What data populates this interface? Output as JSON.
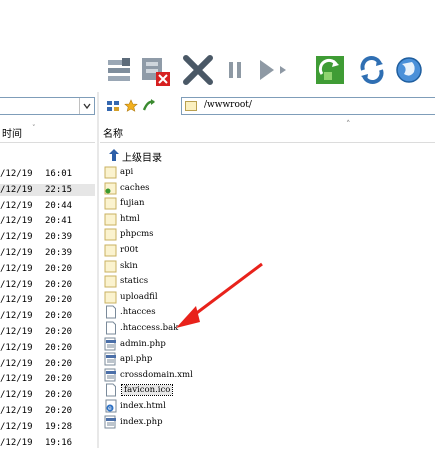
{
  "left_pane": {
    "header": "时间",
    "rows": [
      {
        "date": "/12/19",
        "time": "16:01"
      },
      {
        "date": "/12/19",
        "time": "22:15",
        "selected": true
      },
      {
        "date": "/12/19",
        "time": "20:44"
      },
      {
        "date": "/12/19",
        "time": "20:41"
      },
      {
        "date": "/12/19",
        "time": "20:39"
      },
      {
        "date": "/12/19",
        "time": "20:39"
      },
      {
        "date": "/12/19",
        "time": "20:20"
      },
      {
        "date": "/12/19",
        "time": "20:20"
      },
      {
        "date": "/12/19",
        "time": "20:20"
      },
      {
        "date": "/12/19",
        "time": "20:20"
      },
      {
        "date": "/12/19",
        "time": "20:20"
      },
      {
        "date": "/12/19",
        "time": "20:20"
      },
      {
        "date": "/12/19",
        "time": "20:20"
      },
      {
        "date": "/12/19",
        "time": "20:20"
      },
      {
        "date": "/12/19",
        "time": "20:20"
      },
      {
        "date": "/12/19",
        "time": "20:20"
      },
      {
        "date": "/12/19",
        "time": "19:28"
      },
      {
        "date": "/12/19",
        "time": "19:16"
      }
    ]
  },
  "right_pane": {
    "path": "/wwwroot/",
    "header": "名称",
    "parent_label": "上级目录",
    "files": [
      {
        "name": "api",
        "type": "folder"
      },
      {
        "name": "caches",
        "type": "folder-special"
      },
      {
        "name": "fujian",
        "type": "folder"
      },
      {
        "name": "html",
        "type": "folder"
      },
      {
        "name": "phpcms",
        "type": "folder"
      },
      {
        "name": "r00t",
        "type": "folder"
      },
      {
        "name": "skin",
        "type": "folder"
      },
      {
        "name": "statics",
        "type": "folder"
      },
      {
        "name": "uploadfil",
        "type": "folder"
      },
      {
        "name": ".htacces",
        "type": "file"
      },
      {
        "name": ".htaccess.bak",
        "type": "file"
      },
      {
        "name": "admin.php",
        "type": "php"
      },
      {
        "name": "api.php",
        "type": "php"
      },
      {
        "name": "crossdomain.xml",
        "type": "xml"
      },
      {
        "name": "favicon.ico",
        "type": "file",
        "selected": true
      },
      {
        "name": "index.html",
        "type": "html"
      },
      {
        "name": "index.php",
        "type": "php"
      }
    ]
  },
  "icons": {
    "transfer": "transfer-queue-icon",
    "delete_queue": "delete-queue-icon",
    "cancel": "cancel-icon",
    "pause": "pause-icon",
    "play": "start-transfer-icon",
    "refresh_green": "refresh-local-icon",
    "refresh_blue": "sync-icon",
    "world": "site-manager-icon"
  },
  "colors": {
    "annotation_arrow": "#e8221b",
    "folder": "#f6df8c",
    "selection": "#e6e6e6"
  }
}
